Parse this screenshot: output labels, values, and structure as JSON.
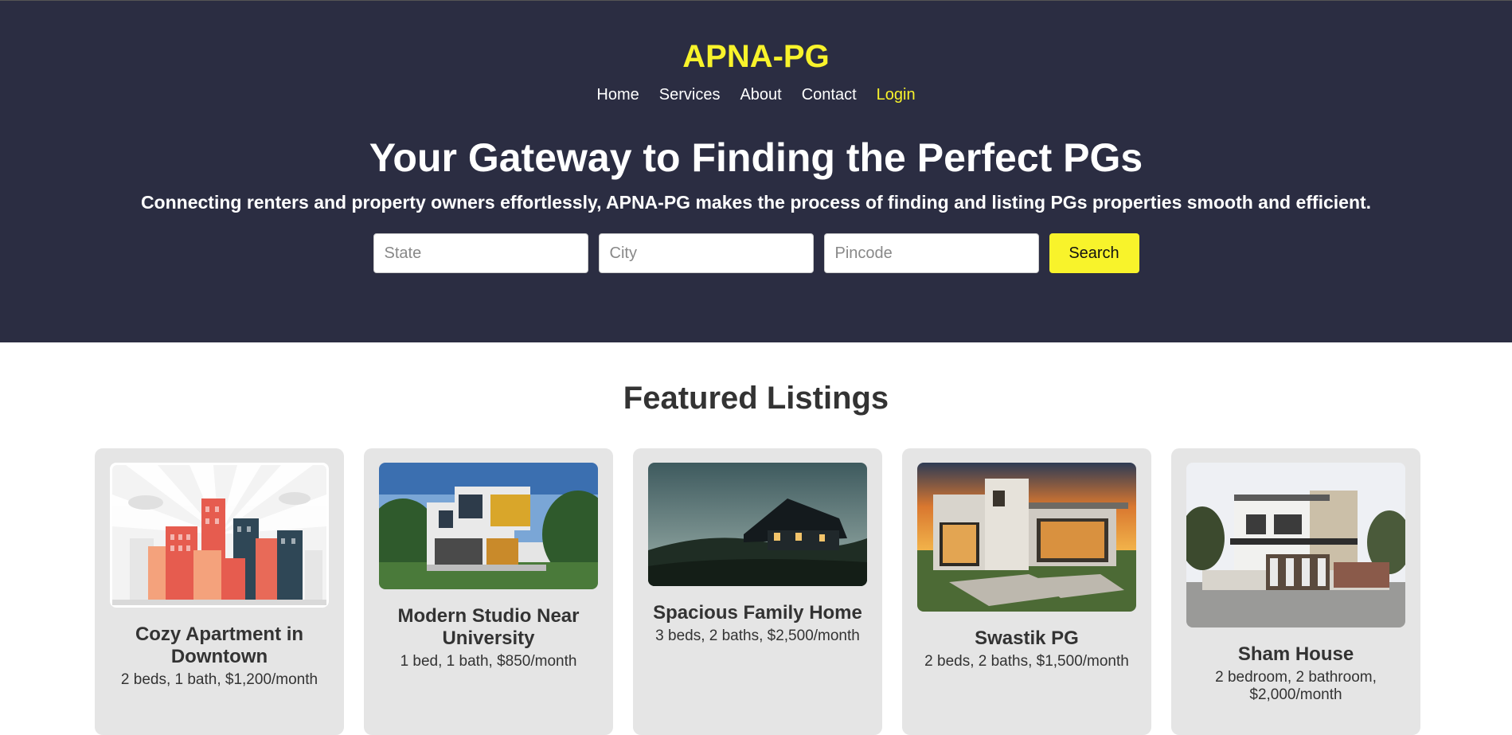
{
  "header": {
    "brand": "APNA-PG",
    "nav": [
      {
        "label": "Home"
      },
      {
        "label": "Services"
      },
      {
        "label": "About"
      },
      {
        "label": "Contact"
      },
      {
        "label": "Login"
      }
    ],
    "accent_color": "#f8f32b",
    "background_color": "#2b2d42"
  },
  "hero": {
    "headline": "Your Gateway to Finding the Perfect PGs",
    "subline": "Connecting renters and property owners effortlessly, APNA-PG makes the process of finding and listing PGs properties smooth and efficient."
  },
  "search": {
    "state_placeholder": "State",
    "city_placeholder": "City",
    "pincode_placeholder": "Pincode",
    "button_label": "Search"
  },
  "featured": {
    "heading": "Featured Listings",
    "listings": [
      {
        "title": "Cozy Apartment in Downtown",
        "details": "2 beds, 1 bath, $1,200/month",
        "image": "illustrated-city-buildings"
      },
      {
        "title": "Modern Studio Near University",
        "details": "1 bed, 1 bath, $850/month",
        "image": "modern-two-storey-house"
      },
      {
        "title": "Spacious Family Home",
        "details": "3 beds, 2 baths, $2,500/month",
        "image": "house-on-hill-at-dusk"
      },
      {
        "title": "Swastik PG",
        "details": "2 beds, 2 baths, $1,500/month",
        "image": "modern-villa-at-sunset"
      },
      {
        "title": "Sham House",
        "details": "2 bedroom, 2 bathroom, $2,000/month",
        "image": "two-storey-house-with-gate"
      }
    ]
  }
}
